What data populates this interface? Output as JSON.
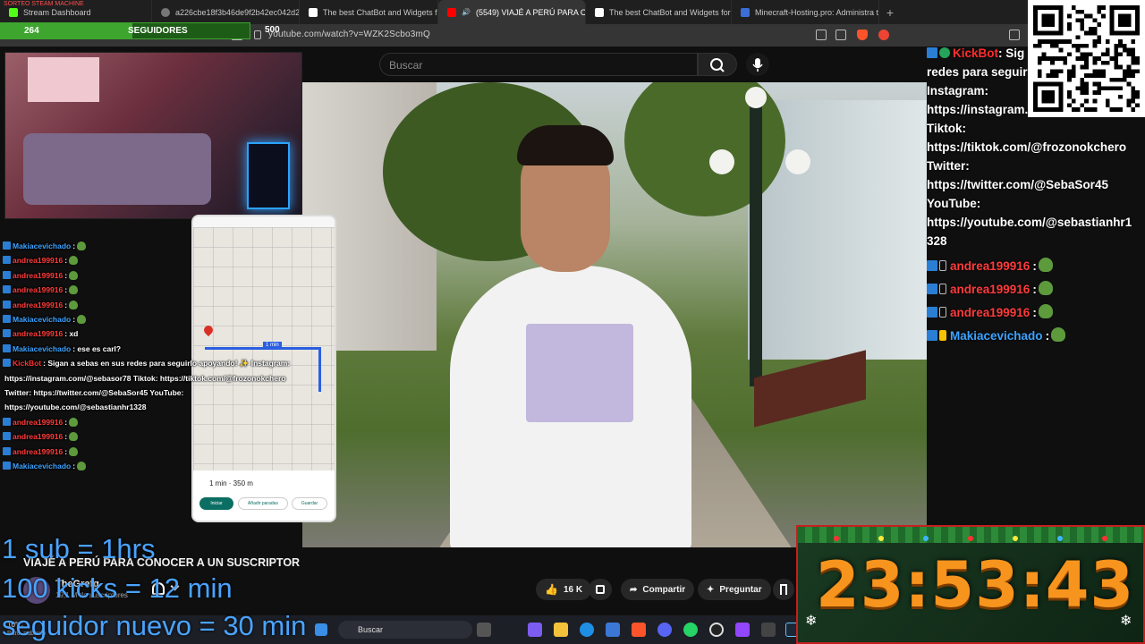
{
  "browser": {
    "tabs": [
      {
        "label": "Stream Dashboard"
      },
      {
        "label": "a226cbe18f3b46de9f2b42ec042d28"
      },
      {
        "label": "The best ChatBot and Widgets for Ki"
      },
      {
        "label": "(5549) VIAJÉ A PERÚ PARA CO"
      },
      {
        "label": "The best ChatBot and Widgets for Ki"
      },
      {
        "label": "Minecraft-Hosting.pro: Administra tu"
      }
    ],
    "new_tab": "+",
    "url": "youtube.com/watch?v=WZK2Scbo3mQ",
    "strip_text": "SORTEO STEAM MACHINE"
  },
  "counters": {
    "followers_value": "264",
    "followers_label": "SEGUIDORES",
    "followers_goal": "500",
    "followers_progress": 0.528
  },
  "youtube": {
    "search_placeholder": "Buscar",
    "video_title": "VIAJÉ A PERÚ PARA CONOCER A UN SUSCRIPTOR",
    "channel_name": "TheGrefg",
    "channel_subs": "19,1 M de suscriptores",
    "like_count": "16 K",
    "share_label": "Compartir",
    "ask_label": "Preguntar"
  },
  "phone_map": {
    "route_label": "1 min",
    "distance": "1 min · 350 m",
    "start_btn": "Iniciar",
    "stops_btn": "Añadir paradas",
    "save_btn": "Guardar"
  },
  "chat_left": [
    {
      "user": "Makiacevichado",
      "msg": ":",
      "color": "blue",
      "emote": "pepe"
    },
    {
      "user": "andrea199916",
      "msg": ":",
      "color": "pink",
      "emote": "pepe"
    },
    {
      "user": "andrea199916",
      "msg": ":",
      "color": "pink",
      "emote": "pepe"
    },
    {
      "user": "andrea199916",
      "msg": ":",
      "color": "pink",
      "emote": "pepe"
    },
    {
      "user": "andrea199916",
      "msg": ":",
      "color": "pink",
      "emote": "pepe"
    },
    {
      "user": "Makiacevichado",
      "msg": ":",
      "color": "blue",
      "emote": "pepe"
    },
    {
      "user": "andrea199916",
      "msg": ": xd",
      "color": "pink",
      "emote": ""
    },
    {
      "user": "Makiacevichado",
      "msg": ": ese es carl?",
      "color": "blue",
      "emote": ""
    },
    {
      "user": "KickBot",
      "msg": ": Sigan a sebas en sus redes para seguirlo apoyando! ✨ Instagram:",
      "color": "red",
      "emote": ""
    },
    {
      "user": "",
      "msg": "https://instagram.com/@sebasor78 Tiktok: https://tiktok.com/@frozonokchero",
      "color": "white",
      "emote": ""
    },
    {
      "user": "",
      "msg": "Twitter: https://twitter.com/@SebaSor45 YouTube:",
      "color": "white",
      "emote": ""
    },
    {
      "user": "",
      "msg": "https://youtube.com/@sebastianhr1328",
      "color": "white",
      "emote": ""
    },
    {
      "user": "andrea199916",
      "msg": ":",
      "color": "pink",
      "emote": "pepe"
    },
    {
      "user": "andrea199916",
      "msg": ":",
      "color": "pink",
      "emote": "pepe"
    },
    {
      "user": "andrea199916",
      "msg": ":",
      "color": "pink",
      "emote": "pepe"
    },
    {
      "user": "Makiacevichado",
      "msg": ":",
      "color": "blue",
      "emote": "pepe"
    }
  ],
  "chat_right": {
    "kickbot_user": "KickBot",
    "kickbot_line1": ": Sig",
    "lines": [
      "redes para seguir",
      "Instagram:",
      "https://instagram.",
      "Tiktok:",
      "https://tiktok.com/@frozonokchero",
      "Twitter:",
      "https://twitter.com/@SebaSor45",
      "YouTube:",
      "https://youtube.com/@sebastianhr1",
      "328"
    ],
    "messages": [
      {
        "user": "andrea199916",
        "msg": ":"
      },
      {
        "user": "andrea199916",
        "msg": ":"
      },
      {
        "user": "andrea199916",
        "msg": ":"
      },
      {
        "user": "Makiacevichado",
        "msg": ":"
      }
    ]
  },
  "overlay_text": {
    "line1": "1 sub = 1hrs",
    "line2": "100 kicks = 12 min",
    "line3": "seguidor nuevo = 30 min"
  },
  "taskbar": {
    "search_placeholder": "Buscar",
    "weather": "10°C",
    "weather_desc": "Parc. nublado"
  },
  "timer": {
    "value": "23:53:43"
  },
  "colors": {
    "accent_green": "#3ea52f",
    "chat_pink": "#ff3b3b",
    "chat_blue": "#3ca2ff",
    "timer_orange": "#f7941d",
    "overlay_blue": "#4aa3ff"
  }
}
